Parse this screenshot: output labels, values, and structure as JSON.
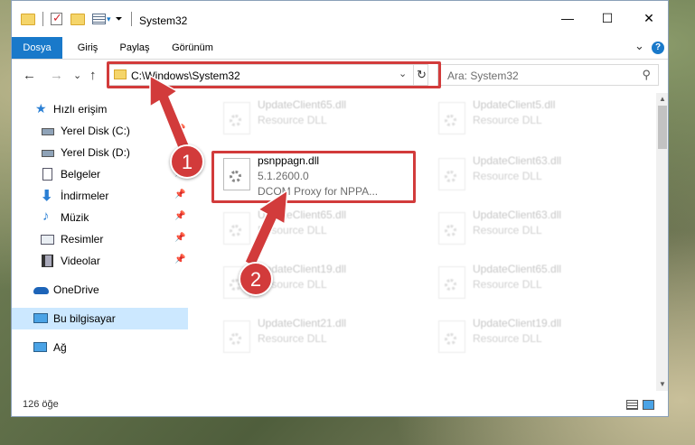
{
  "window": {
    "title": "System32",
    "minimize_glyph": "—",
    "maximize_glyph": "☐",
    "close_glyph": "✕"
  },
  "ribbon": {
    "tabs": [
      "Dosya",
      "Giriş",
      "Paylaş",
      "Görünüm"
    ],
    "expand_glyph": "⌄",
    "help_glyph": "?"
  },
  "nav": {
    "back_glyph": "←",
    "forward_glyph": "→",
    "recent_glyph": "⌄",
    "up_glyph": "↑"
  },
  "address": {
    "path": "C:\\Windows\\System32",
    "dropdown_glyph": "⌄",
    "refresh_glyph": "↻"
  },
  "search": {
    "placeholder": "Ara: System32",
    "icon": "search-icon"
  },
  "sidebar": {
    "items": [
      {
        "label": "Hızlı erişim",
        "icon": "star-icon"
      },
      {
        "label": "Yerel Disk (C:)",
        "icon": "drive-icon"
      },
      {
        "label": "Yerel Disk (D:)",
        "icon": "drive-icon"
      },
      {
        "label": "Belgeler",
        "icon": "document-icon"
      },
      {
        "label": "İndirmeler",
        "icon": "download-icon"
      },
      {
        "label": "Müzik",
        "icon": "music-icon"
      },
      {
        "label": "Resimler",
        "icon": "pictures-icon"
      },
      {
        "label": "Videolar",
        "icon": "video-icon"
      },
      {
        "label": "OneDrive",
        "icon": "cloud-icon"
      },
      {
        "label": "Bu bilgisayar",
        "icon": "computer-icon"
      },
      {
        "label": "Ağ",
        "icon": "network-icon"
      }
    ],
    "pin_glyph": "📌"
  },
  "files": {
    "focus": {
      "name": "psnppagn.dll",
      "version": "5.1.2600.0",
      "description": "DCOM Proxy for NPPA..."
    },
    "left": [
      {
        "name": "UpdateClient65.dll",
        "type": "Resource DLL"
      },
      {
        "name": "UpdateClient65.dll",
        "type": "Resource DLL"
      },
      {
        "name": "UpdateClient19.dll",
        "type": "Resource DLL"
      },
      {
        "name": "UpdateClient21.dll",
        "type": "Resource DLL"
      }
    ],
    "right": [
      {
        "name": "UpdateClient5.dll",
        "type": "Resource DLL"
      },
      {
        "name": "UpdateClient63.dll",
        "type": "Resource DLL"
      },
      {
        "name": "UpdateClient63.dll",
        "type": "Resource DLL"
      },
      {
        "name": "UpdateClient65.dll",
        "type": "Resource DLL"
      },
      {
        "name": "UpdateClient19.dll",
        "type": "Resource DLL"
      }
    ]
  },
  "status": {
    "item_count": "126 öğe"
  },
  "callouts": [
    "1",
    "2"
  ],
  "colors": {
    "accent": "#1979ca",
    "highlight": "#d23b3b",
    "selected": "#cce8ff"
  }
}
